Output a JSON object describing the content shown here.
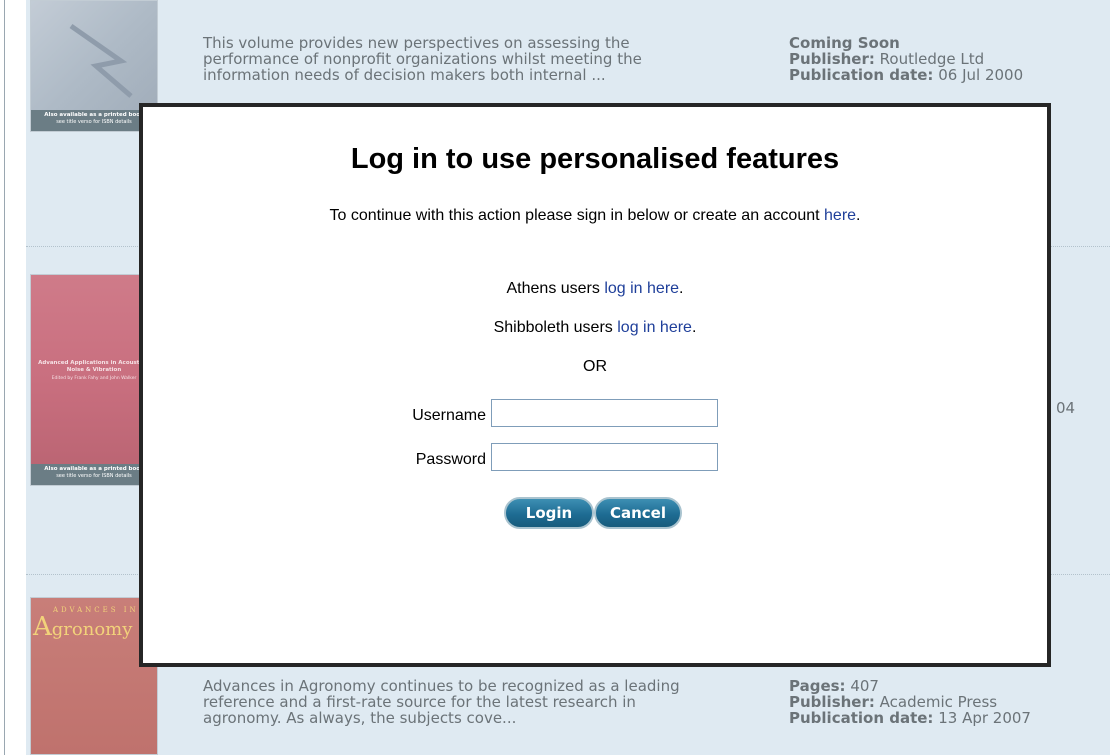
{
  "books": [
    {
      "status_label": "Coming Soon",
      "description": "This volume provides new perspectives on assessing the performance of nonprofit organizations whilst meeting the information needs of decision makers both internal ...",
      "publisher_label": "Publisher:",
      "publisher": "Routledge Ltd",
      "date_label": "Publication date:",
      "date": "06 Jul 2000",
      "cover_band_1": "Also available as a printed book",
      "cover_band_2": "see title verso for ISBN details"
    },
    {
      "partial_value": "04",
      "cover_title": "Advanced Applications in Acoustics, Noise & Vibration",
      "cover_editors": "Edited by Frank Fahy and John Walker",
      "cover_band_1": "Also available as a printed book",
      "cover_band_2": "see title verso for ISBN details"
    },
    {
      "description": "Advances in Agronomy continues to be recognized as a leading reference and a first-rate source for the latest research in agronomy. As always, the subjects cove...",
      "pages_label": "Pages:",
      "pages": "407",
      "publisher_label": "Publisher:",
      "publisher": "Academic Press",
      "date_label": "Publication date:",
      "date": "13 Apr 2007",
      "cover_series": "ADVANCES IN",
      "cover_brand_initial": "A",
      "cover_brand_rest": "gronomy"
    }
  ],
  "modal": {
    "title": "Log in to use personalised features",
    "intro_text": "To continue with this action please sign in below or create an account ",
    "intro_link": "here",
    "intro_end": ".",
    "athens_text": "Athens users ",
    "athens_link": "log in here",
    "athens_end": ".",
    "shib_text": "Shibboleth users ",
    "shib_link": "log in here",
    "shib_end": ".",
    "or_text": "OR",
    "username_label": "Username",
    "username_value": "",
    "password_label": "Password",
    "password_value": "",
    "login_button": "Login",
    "cancel_button": "Cancel"
  }
}
